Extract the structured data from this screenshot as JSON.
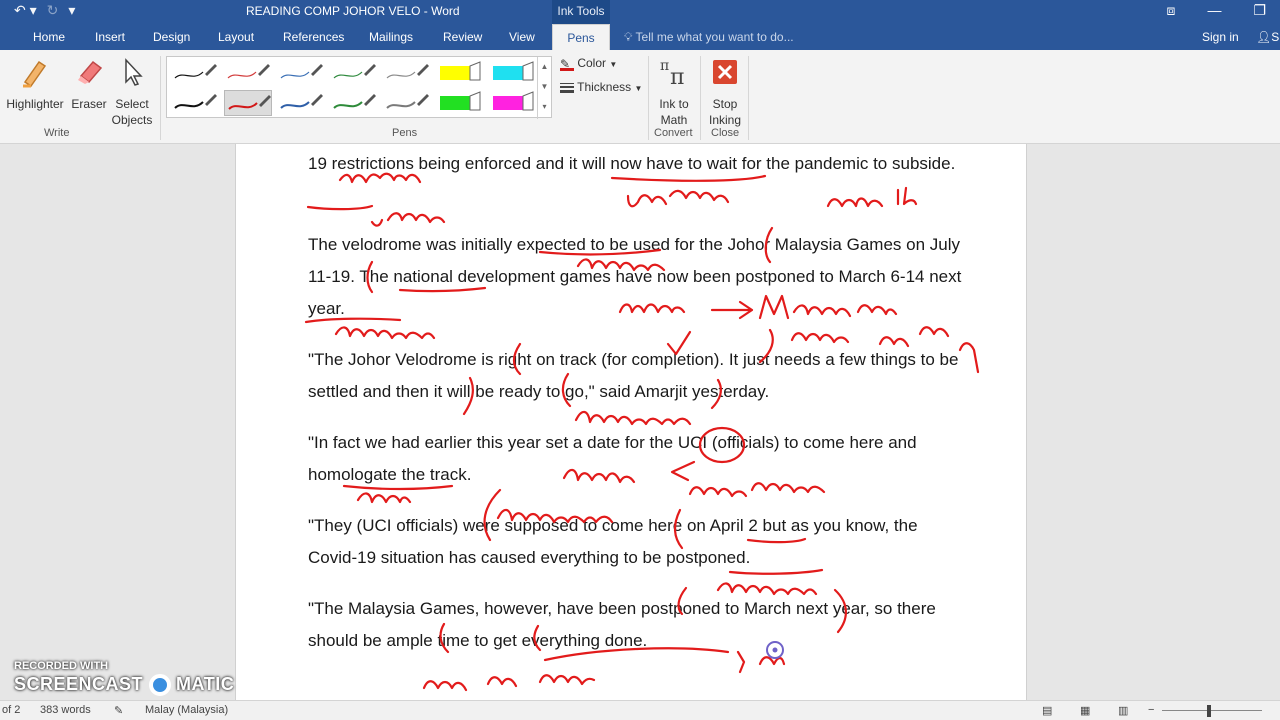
{
  "titlebar": {
    "title": "READING COMP JOHOR VELO - Word",
    "contextual_tab": "Ink Tools"
  },
  "tabs": [
    {
      "label": "Home",
      "active": false
    },
    {
      "label": "Insert",
      "active": false
    },
    {
      "label": "Design",
      "active": false
    },
    {
      "label": "Layout",
      "active": false
    },
    {
      "label": "References",
      "active": false
    },
    {
      "label": "Mailings",
      "active": false
    },
    {
      "label": "Review",
      "active": false
    },
    {
      "label": "View",
      "active": false
    },
    {
      "label": "Pens",
      "active": true
    }
  ],
  "tell_me": "Tell me what you want to do...",
  "sign_in": "Sign in",
  "ribbon": {
    "highlighter": "Highlighter",
    "eraser": "Eraser",
    "select_objects_1": "Select",
    "select_objects_2": "Objects",
    "write_group": "Write",
    "pens_group": "Pens",
    "color": "Color",
    "thickness": "Thickness",
    "ink_to_math_1": "Ink to",
    "ink_to_math_2": "Math",
    "convert_group": "Convert",
    "stop_inking_1": "Stop",
    "stop_inking_2": "Inking",
    "close_group": "Close"
  },
  "pen_colors": [
    "#111111",
    "#d23b3b",
    "#3a6fb5",
    "#2f8a3e",
    "#8a8a8a",
    "#ffff00",
    "#1fe0f0",
    "#111111",
    "#d21818",
    "#2f5fa8",
    "#2e8b3a",
    "#7a7a7a",
    "#22e022",
    "#ff22e0"
  ],
  "document": {
    "paragraphs": [
      "19 restrictions being enforced and it will now have to wait for the pandemic to subside.",
      "The velodrome was initially expected to be used for the Johor Malaysia Games on July 11-19. The national development games have now been postponed to March 6-14 next year.",
      "\"The Johor Velodrome is right on track (for completion). It just needs a few things to be settled and then it will be ready to go,\" said Amarjit yesterday.",
      "\"In fact we had earlier this year set a date for the UCI (officials) to come here and homologate the track.",
      "\"They (UCI officials) were supposed to come here on April 2 but as you know, the Covid-19 situation has caused everything to be postponed.",
      "\"The Malaysia Games, however, have been postponed to March next year, so there should be ample time to get everything done."
    ]
  },
  "status": {
    "page": "of 2",
    "words": "383 words",
    "language": "Malay (Malaysia)"
  },
  "watermark": {
    "line1": "RECORDED WITH",
    "line2": "SCREENCAST",
    "line3": "MATIC"
  },
  "ink_color": "#e21b1b"
}
